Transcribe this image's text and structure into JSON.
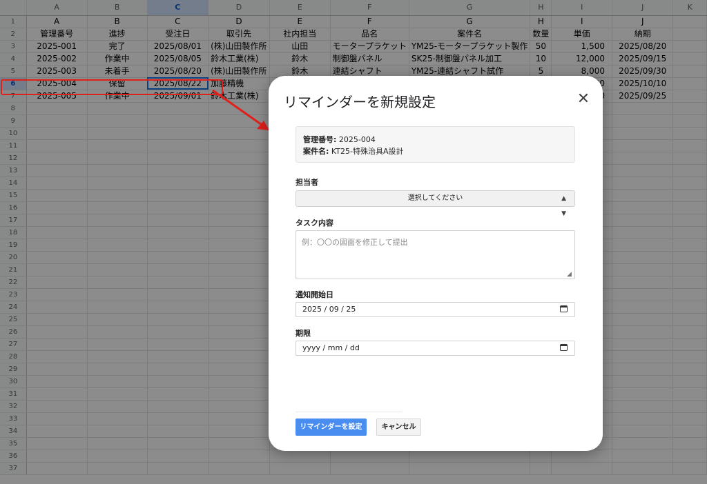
{
  "sheet": {
    "col_letters": [
      "A",
      "B",
      "C",
      "D",
      "E",
      "F",
      "G",
      "H",
      "I",
      "J",
      "K"
    ],
    "headers": [
      "管理番号",
      "進捗",
      "受注日",
      "取引先",
      "社内担当",
      "品名",
      "案件名",
      "数量",
      "単価",
      "納期"
    ],
    "rows": [
      [
        "2025-001",
        "完了",
        "2025/08/01",
        "(株)山田製作所",
        "山田",
        "モータープラケット",
        "YM25-モータープラケット製作",
        "50",
        "1,500",
        "2025/08/20"
      ],
      [
        "2025-002",
        "作業中",
        "2025/08/05",
        "鈴木工業(株)",
        "鈴木",
        "制御盤パネル",
        "SK25-制御盤パネル加工",
        "10",
        "12,000",
        "2025/09/15"
      ],
      [
        "2025-003",
        "未着手",
        "2025/08/20",
        "(株)山田製作所",
        "鈴木",
        "連結シャフト",
        "YM25-連結シャフト試作",
        "5",
        "8,000",
        "2025/09/30"
      ],
      [
        "2025-004",
        "保留",
        "2025/08/22",
        "加藤精機",
        "",
        "",
        "",
        "",
        "000",
        "2025/10/10"
      ],
      [
        "2025-005",
        "作業中",
        "2025/09/01",
        "鈴木工業(株)",
        "",
        "",
        "",
        "",
        "000",
        "2025/09/25"
      ]
    ]
  },
  "dialog": {
    "title": "リマインダーを新規設定",
    "close_glyph": "✕",
    "info": {
      "id_label": "管理番号:",
      "id_value": "2025-004",
      "case_label": "案件名:",
      "case_value": "KT25-特殊治具A設計"
    },
    "assignee_label": "担当者",
    "assignee_value": "選択してください",
    "task_label": "タスク内容",
    "task_placeholder": "例：〇〇の図面を修正して提出",
    "start_label": "通知開始日",
    "start_value": "2025 / 09 / 25",
    "due_label": "期限",
    "due_value": "yyyy / mm / dd",
    "submit_label": "リマインダーを設定",
    "cancel_label": "キャンセル"
  },
  "colors": {
    "accent": "#4a8df0",
    "highlight": "#e0201b",
    "selection": "#1a73e8"
  },
  "icons": {
    "close": "close-icon",
    "calendar": "calendar-icon",
    "select": "select-arrows-icon"
  }
}
